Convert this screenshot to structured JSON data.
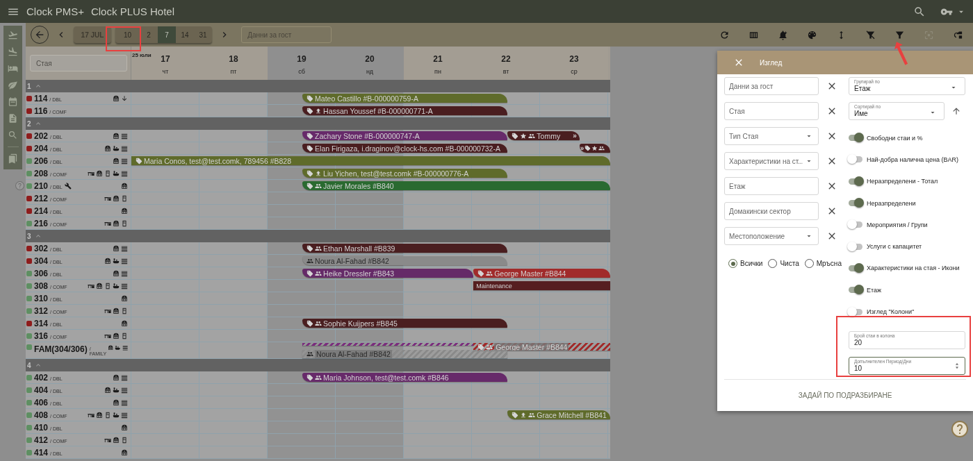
{
  "topbar": {
    "app_name": "Clock PMS+",
    "hotel": "Clock PLUS Hotel"
  },
  "rail": [
    {
      "kind": "departures"
    },
    {
      "kind": "arrivals"
    },
    {
      "kind": "rooms"
    },
    {
      "kind": "housekeeping"
    },
    {
      "kind": "calendar"
    },
    {
      "kind": "reports"
    },
    {
      "kind": "search"
    },
    {
      "kind": "divider"
    },
    {
      "kind": "bookmarks"
    }
  ],
  "toolbar": {
    "date": "17 JUL",
    "ranges": [
      {
        "label": "10",
        "selected": false
      },
      {
        "label": "2",
        "selected": false
      },
      {
        "label": "7",
        "selected": true
      },
      {
        "label": "14",
        "selected": false
      },
      {
        "label": "31",
        "selected": false
      }
    ],
    "guest_placeholder": "Данни за гост",
    "tools": [
      {
        "kind": "refresh",
        "disabled": false
      },
      {
        "kind": "columns",
        "disabled": false
      },
      {
        "kind": "bell",
        "disabled": false
      },
      {
        "kind": "palette",
        "disabled": false
      },
      {
        "kind": "height",
        "disabled": false
      },
      {
        "kind": "filter_off",
        "disabled": false
      },
      {
        "kind": "filter",
        "disabled": false
      },
      {
        "kind": "focus",
        "disabled": true
      },
      {
        "kind": "swap",
        "disabled": false
      }
    ]
  },
  "grid": {
    "room_placeholder": "Стая",
    "month": "25 юли",
    "days": [
      {
        "date": "17",
        "weekday": "чт",
        "weekend": false
      },
      {
        "date": "18",
        "weekday": "пт",
        "weekend": false
      },
      {
        "date": "19",
        "weekday": "сб",
        "weekend": true
      },
      {
        "date": "20",
        "weekday": "нд",
        "weekend": true
      },
      {
        "date": "21",
        "weekday": "пн",
        "weekend": false
      },
      {
        "date": "22",
        "weekday": "вт",
        "weekend": false
      },
      {
        "date": "23",
        "weekday": "ср",
        "weekend": false
      }
    ],
    "groups": [
      {
        "label": "1",
        "expanded": true,
        "rooms": [
          {
            "number": "114",
            "type": "/ DBL",
            "color": "#8e1c1c",
            "maintenance": false,
            "features": [
              {
                "kind": "heater"
              },
              {
                "kind": "down"
              }
            ],
            "bookings": [
              {
                "kind": "reservation",
                "label": "Mateo Castillo #B-000000759-A",
                "color": "#5f6b2b",
                "icons": [
                  {
                    "kind": "tag"
                  }
                ]
              }
            ]
          },
          {
            "number": "116",
            "type": "/ COMF",
            "color": "#8e1c1c",
            "maintenance": false,
            "bookings": [
              {
                "kind": "reservation",
                "label": "Hassan Youssef #B-000000771-A",
                "color": "#4a1e20",
                "icons": [
                  {
                    "kind": "tag"
                  },
                  {
                    "kind": "upload"
                  }
                ]
              }
            ]
          }
        ]
      },
      {
        "label": "2",
        "expanded": true,
        "rooms": [
          {
            "number": "202",
            "type": "/ DBL",
            "color": "#8e1c1c",
            "maintenance": false,
            "features": [
              {
                "kind": "heater"
              },
              {
                "kind": "waves"
              }
            ],
            "bookings": [
              {
                "kind": "reservation",
                "label": "Zachary Stone #B-000000747-A",
                "color": "#672a6a",
                "icons": [
                  {
                    "kind": "tag"
                  }
                ]
              },
              {
                "kind": "reservation",
                "label": "Tommy",
                "trail": "»",
                "color": "#4a1e20",
                "icons": [
                  {
                    "kind": "tag"
                  },
                  {
                    "kind": "star"
                  },
                  {
                    "kind": "group"
                  }
                ]
              }
            ]
          },
          {
            "number": "204",
            "type": "/ DBL",
            "color": "#8e1c1c",
            "maintenance": false,
            "features": [
              {
                "kind": "heater"
              },
              {
                "kind": "bath"
              },
              {
                "kind": "waves"
              }
            ],
            "bookings": [
              {
                "kind": "reservation",
                "label": "Elan Firigaza, i.draginov@clock-hs.com #B-000000732-A",
                "color": "#4a1e20",
                "icons": [
                  {
                    "kind": "tag"
                  }
                ]
              },
              {
                "kind": "reservation",
                "lead": "»",
                "color": "#4a1e20",
                "icons": [
                  {
                    "kind": "tag"
                  },
                  {
                    "kind": "star"
                  },
                  {
                    "kind": "group"
                  }
                ]
              }
            ]
          },
          {
            "number": "206",
            "type": "/ DBL",
            "color": "#5e8f62",
            "maintenance": false,
            "features": [
              {
                "kind": "heater"
              },
              {
                "kind": "waves"
              }
            ],
            "bookings": [
              {
                "kind": "reservation",
                "label": "Maria Conos, test@test.comk, 789456 #B828",
                "color": "#5f6b2b",
                "icons": [
                  {
                    "kind": "tag"
                  }
                ]
              }
            ]
          },
          {
            "number": "208",
            "type": "/ COMF",
            "color": "#5e8f62",
            "maintenance": false,
            "features": [
              {
                "kind": "desk"
              },
              {
                "kind": "heater"
              },
              {
                "kind": "fridge"
              },
              {
                "kind": "bath"
              },
              {
                "kind": "waves"
              }
            ],
            "bookings": [
              {
                "kind": "reservation",
                "label": "Liu Yichen, test@test.comk #B-000000776-A",
                "color": "#5f6b2b",
                "icons": [
                  {
                    "kind": "tag"
                  },
                  {
                    "kind": "upload"
                  }
                ]
              }
            ]
          },
          {
            "number": "210",
            "type": "/ DBL",
            "color": "#5e8f62",
            "maintenance": true,
            "features": [
              {
                "kind": "heater"
              }
            ],
            "bookings": [
              {
                "kind": "reservation",
                "label": "Javier Morales #B840",
                "color": "#2a6a30",
                "icons": [
                  {
                    "kind": "tag"
                  },
                  {
                    "kind": "group"
                  }
                ]
              }
            ]
          },
          {
            "number": "212",
            "type": "/ COMF",
            "color": "#8e1c1c",
            "maintenance": false,
            "features": [
              {
                "kind": "desk"
              },
              {
                "kind": "heater"
              },
              {
                "kind": "fridge"
              }
            ]
          },
          {
            "number": "214",
            "type": "/ DBL",
            "color": "#8e1c1c",
            "maintenance": false,
            "features": [
              {
                "kind": "heater"
              }
            ]
          },
          {
            "number": "216",
            "type": "/ COMF",
            "color": "#5e8f62",
            "maintenance": false,
            "features": [
              {
                "kind": "desk"
              },
              {
                "kind": "heater"
              },
              {
                "kind": "fridge"
              }
            ]
          }
        ]
      },
      {
        "label": "3",
        "expanded": true,
        "rooms": [
          {
            "number": "302",
            "type": "/ DBL",
            "color": "#8e1c1c",
            "maintenance": false,
            "features": [
              {
                "kind": "heater"
              },
              {
                "kind": "waves"
              }
            ],
            "bookings": [
              {
                "kind": "reservation",
                "label": "Ethan Marshall #B839",
                "color": "#4a1e20",
                "icons": [
                  {
                    "kind": "tag"
                  },
                  {
                    "kind": "group"
                  }
                ]
              }
            ]
          },
          {
            "number": "304",
            "type": "/ DBL",
            "color": "#8e1c1c",
            "maintenance": false,
            "features": [
              {
                "kind": "heater"
              },
              {
                "kind": "bath"
              },
              {
                "kind": "waves"
              }
            ],
            "bookings": [
              {
                "kind": "reservation",
                "label": "Noura Al-Fahad #B842",
                "color": "#8a8a8a",
                "icons": [
                  {
                    "kind": "group"
                  }
                ]
              }
            ]
          },
          {
            "number": "306",
            "type": "/ DBL",
            "color": "#5e8f62",
            "maintenance": false,
            "features": [
              {
                "kind": "heater"
              },
              {
                "kind": "waves"
              }
            ],
            "bookings": [
              {
                "kind": "reservation",
                "label": "Heike Dressler #B843",
                "color": "#652a68",
                "icons": [
                  {
                    "kind": "tag"
                  },
                  {
                    "kind": "group"
                  }
                ]
              },
              {
                "kind": "reservation",
                "label": "George Master #B844",
                "color": "#a12b2b",
                "icons": [
                  {
                    "kind": "tag"
                  },
                  {
                    "kind": "group"
                  }
                ]
              }
            ]
          },
          {
            "number": "308",
            "type": "/ COMF",
            "color": "#5e8f62",
            "maintenance": false,
            "features": [
              {
                "kind": "desk"
              },
              {
                "kind": "heater"
              },
              {
                "kind": "fridge"
              },
              {
                "kind": "bath"
              },
              {
                "kind": "waves"
              }
            ],
            "bookings": [
              {
                "kind": "block",
                "label": "Maintenance",
                "color": "#561e20"
              }
            ]
          },
          {
            "number": "310",
            "type": "/ DBL",
            "color": "#5e8f62",
            "maintenance": false,
            "features": [
              {
                "kind": "heater"
              }
            ]
          },
          {
            "number": "312",
            "type": "/ COMF",
            "color": "#5e8f62",
            "maintenance": false,
            "features": [
              {
                "kind": "desk"
              },
              {
                "kind": "heater"
              },
              {
                "kind": "fridge"
              }
            ]
          },
          {
            "number": "314",
            "type": "/ DBL",
            "color": "#8e1c1c",
            "maintenance": false,
            "features": [
              {
                "kind": "heater"
              }
            ],
            "bookings": [
              {
                "kind": "reservation",
                "label": "Sophie Kuijpers #B845",
                "color": "#4a1e20",
                "icons": [
                  {
                    "kind": "tag"
                  },
                  {
                    "kind": "group"
                  }
                ]
              }
            ]
          },
          {
            "number": "316",
            "type": "/ COMF",
            "color": "#5e8f62",
            "maintenance": false,
            "features": [
              {
                "kind": "desk"
              },
              {
                "kind": "heater"
              },
              {
                "kind": "fridge"
              }
            ]
          },
          {
            "number": "FAM(304/306)",
            "type": "/ FAMILY",
            "color": "#5e8f62",
            "maintenance": false,
            "features": [
              {
                "kind": "heater"
              },
              {
                "kind": "bath"
              },
              {
                "kind": "waves"
              }
            ],
            "bookings": [
              {
                "kind": "stripe",
                "color": "#7a2d7e",
                "hatched": true,
                "lower": false
              },
              {
                "kind": "reservation",
                "label": "George Master #B844",
                "color": "#a12b2b",
                "icons": [
                  {
                    "kind": "tag"
                  },
                  {
                    "kind": "group"
                  }
                ],
                "hatched": true,
                "lower": false
              },
              {
                "kind": "reservation",
                "label": "Noura Al-Fahad #B842",
                "color": "#8a8a8a",
                "icons": [
                  {
                    "kind": "group"
                  }
                ],
                "hatched": true,
                "lower": true
              }
            ]
          }
        ]
      },
      {
        "label": "4",
        "expanded": true,
        "rooms": [
          {
            "number": "402",
            "type": "/ DBL",
            "color": "#5e8f62",
            "maintenance": false,
            "features": [
              {
                "kind": "heater"
              },
              {
                "kind": "waves"
              }
            ],
            "bookings": [
              {
                "kind": "reservation",
                "label": "Maria Johnson, test@test.comk #B846",
                "color": "#672a6a",
                "icons": [
                  {
                    "kind": "tag"
                  },
                  {
                    "kind": "group"
                  }
                ]
              }
            ]
          },
          {
            "number": "404",
            "type": "/ DBL",
            "color": "#5e8f62",
            "maintenance": false,
            "features": [
              {
                "kind": "heater"
              },
              {
                "kind": "bath"
              },
              {
                "kind": "waves"
              }
            ]
          },
          {
            "number": "406",
            "type": "/ DBL",
            "color": "#5e8f62",
            "maintenance": false,
            "features": [
              {
                "kind": "heater"
              },
              {
                "kind": "waves"
              }
            ]
          },
          {
            "number": "408",
            "type": "/ COMF",
            "color": "#5e8f62",
            "maintenance": false,
            "features": [
              {
                "kind": "desk"
              },
              {
                "kind": "heater"
              },
              {
                "kind": "fridge"
              },
              {
                "kind": "bath"
              },
              {
                "kind": "waves"
              }
            ],
            "bookings": [
              {
                "kind": "reservation",
                "label": "Grace Mitchell #B841",
                "color": "#5f6b2b",
                "icons": [
                  {
                    "kind": "tag"
                  },
                  {
                    "kind": "upload"
                  },
                  {
                    "kind": "group"
                  }
                ]
              }
            ]
          },
          {
            "number": "410",
            "type": "/ DBL",
            "color": "#5e8f62",
            "maintenance": false,
            "features": [
              {
                "kind": "heater"
              }
            ]
          },
          {
            "number": "412",
            "type": "/ COMF",
            "color": "#5e8f62",
            "maintenance": false,
            "features": [
              {
                "kind": "desk"
              },
              {
                "kind": "heater"
              },
              {
                "kind": "fridge"
              }
            ]
          },
          {
            "number": "414",
            "type": "/ DBL",
            "color": "#5e8f62",
            "maintenance": false,
            "features": [
              {
                "kind": "heater"
              }
            ]
          }
        ]
      }
    ]
  },
  "panel": {
    "title": "Изглед",
    "filters": [
      {
        "placeholder": "Данни за гост",
        "dropdown": false
      },
      {
        "placeholder": "Стая",
        "dropdown": false
      },
      {
        "placeholder": "Тип Стая",
        "dropdown": true
      },
      {
        "placeholder": "Характеристики на ст...",
        "dropdown": true
      },
      {
        "placeholder": "Етаж",
        "dropdown": false
      },
      {
        "placeholder": "Домакински сектор",
        "dropdown": false
      },
      {
        "placeholder": "Местоположение",
        "dropdown": true
      }
    ],
    "radios": [
      {
        "label": "Всички",
        "selected": true
      },
      {
        "label": "Чиста",
        "selected": false
      },
      {
        "label": "Мръсна",
        "selected": false
      }
    ],
    "selects": [
      {
        "label": "Групирай по",
        "value": "Етаж"
      },
      {
        "label": "Сортирай по",
        "value": "Име",
        "sort_ascending": true
      }
    ],
    "toggles": [
      {
        "label": "Свободни стаи и %",
        "on": true
      },
      {
        "label": "Най-добра налична цена (BAR)",
        "on": false
      },
      {
        "label": "Неразпределени - Тотал",
        "on": true
      },
      {
        "label": "Неразпределени",
        "on": true
      },
      {
        "label": "Мероприятия / Групи",
        "on": false
      },
      {
        "label": "Услуги с капацитет",
        "on": false
      },
      {
        "label": "Характеристики на стая - Икони",
        "on": true
      },
      {
        "label": "Етаж",
        "on": true
      },
      {
        "label": "Изглед \"Колони\"",
        "on": false
      }
    ],
    "numbers": [
      {
        "label": "Брой стаи в колона",
        "value": "20",
        "focused": false
      },
      {
        "label": "Допълнителен Период/Дни",
        "value": "10",
        "focused": true
      }
    ],
    "reset": "ЗАДАЙ ПО ПОДРАЗБИРАНЕ"
  }
}
